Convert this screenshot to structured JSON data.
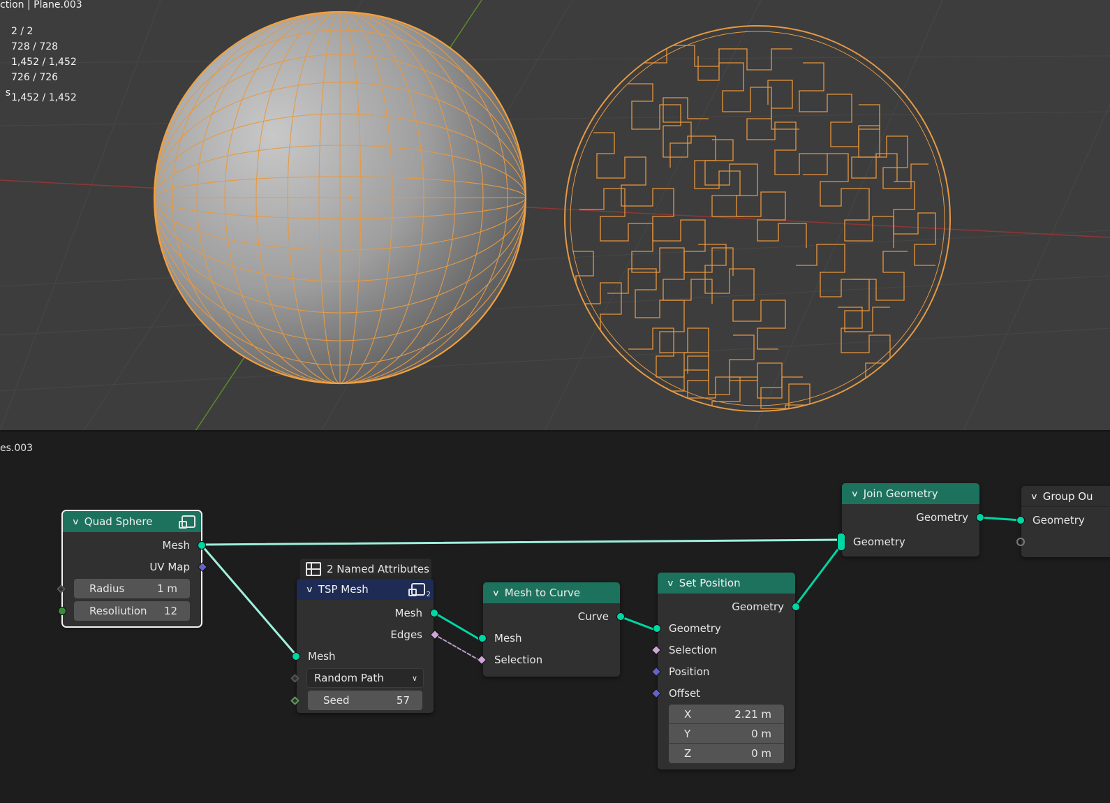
{
  "viewport": {
    "title": "ction | Plane.003",
    "stats": [
      {
        "label": "",
        "value": "2 / 2"
      },
      {
        "label": "",
        "value": "728 / 728"
      },
      {
        "label": "",
        "value": "1,452 / 1,452"
      },
      {
        "label": "",
        "value": "726 / 726"
      },
      {
        "label": "s",
        "value": "1,452 / 1,452"
      }
    ],
    "colors": {
      "background": "#3d3d3d",
      "selection_outline": "#f0a040",
      "x_axis": "#9a3a3a",
      "y_axis": "#5b8a2e"
    }
  },
  "node_editor": {
    "title": "es.003",
    "frame_label": "2 Named Attributes",
    "nodes": {
      "quad_sphere": {
        "title": "Quad Sphere",
        "outputs": [
          "Mesh",
          "UV Map"
        ],
        "fields": [
          {
            "label": "Radius",
            "value": "1 m"
          },
          {
            "label": "Resoliution",
            "value": "12"
          }
        ]
      },
      "tsp_mesh": {
        "title": "TSP Mesh",
        "badge": "2",
        "outputs": [
          "Mesh",
          "Edges"
        ],
        "input": "Mesh",
        "select_value": "Random Path",
        "seed": {
          "label": "Seed",
          "value": "57"
        }
      },
      "mesh_to_curve": {
        "title": "Mesh to Curve",
        "output": "Curve",
        "inputs": [
          "Mesh",
          "Selection"
        ]
      },
      "set_position": {
        "title": "Set Position",
        "output": "Geometry",
        "inputs": [
          "Geometry",
          "Selection",
          "Position",
          "Offset"
        ],
        "offset": [
          {
            "axis": "X",
            "value": "2.21 m"
          },
          {
            "axis": "Y",
            "value": "0 m"
          },
          {
            "axis": "Z",
            "value": "0 m"
          }
        ]
      },
      "join_geometry": {
        "title": "Join Geometry",
        "output": "Geometry",
        "input": "Geometry"
      },
      "group_output": {
        "title": "Group Ou",
        "input": "Geometry"
      }
    },
    "colors": {
      "geometry_socket": "#00d6a3",
      "node_header": "#1d725e",
      "group_header": "#1e2b55",
      "link": "#7fe8d0"
    }
  }
}
